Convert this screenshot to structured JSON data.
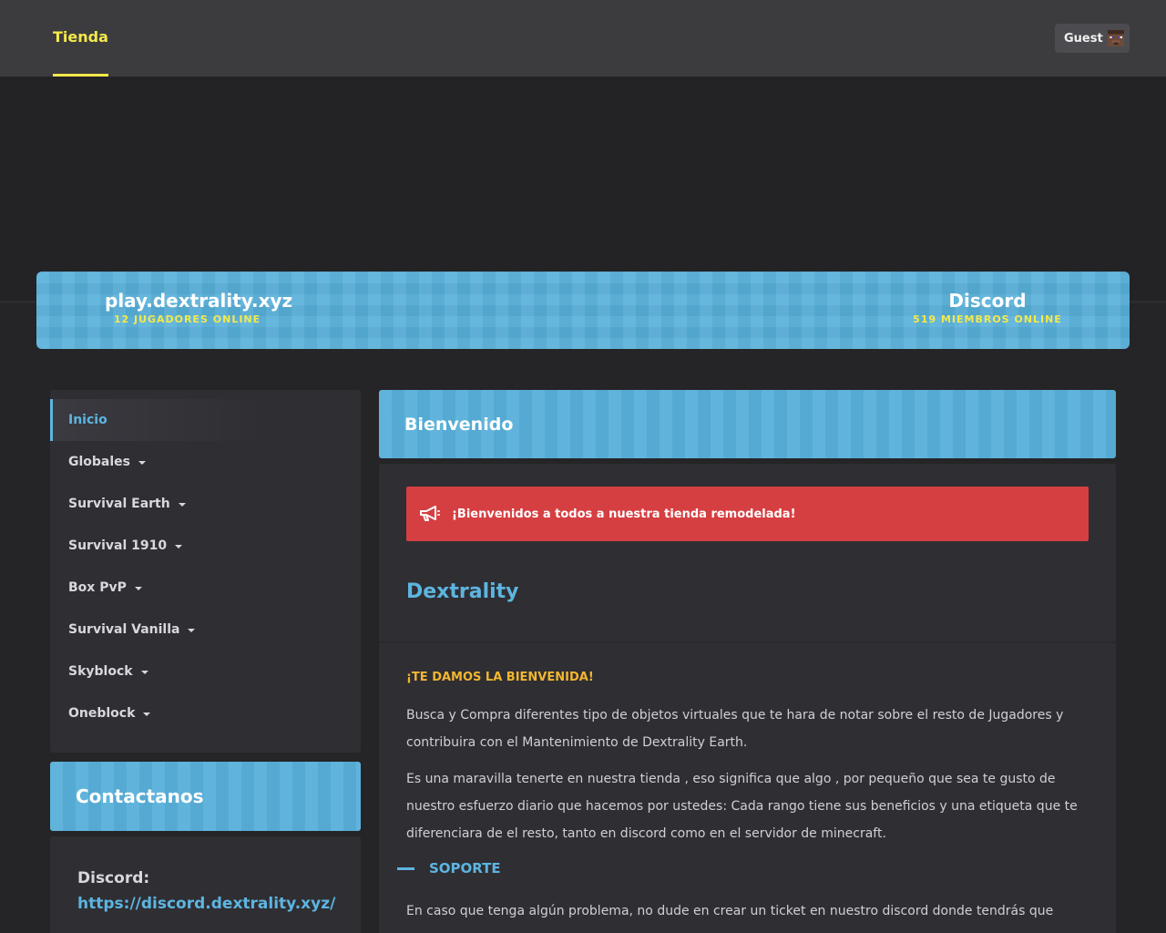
{
  "topbar": {
    "brand": "Tienda",
    "user_label": "Guest"
  },
  "server": {
    "address": "play.dextrality.xyz",
    "players": "12 JUGADORES ONLINE",
    "discord_title": "Discord",
    "discord_members": "519 MIEMBROS ONLINE"
  },
  "sidebar": {
    "items": [
      {
        "label": "Inicio",
        "active": true
      },
      {
        "label": "Globales",
        "dropdown": true
      },
      {
        "label": "Survival Earth",
        "dropdown": true
      },
      {
        "label": "Survival 1910",
        "dropdown": true
      },
      {
        "label": "Box PvP",
        "dropdown": true
      },
      {
        "label": "Survival Vanilla",
        "dropdown": true
      },
      {
        "label": "Skyblock",
        "dropdown": true
      },
      {
        "label": "Oneblock",
        "dropdown": true
      }
    ]
  },
  "contact": {
    "title": "Contactanos",
    "discord_label": "Discord:",
    "discord_link": "https://discord.dextrality.xyz/"
  },
  "main": {
    "title": "Bienvenido",
    "alert": "¡Bienvenidos a todos a nuestra tienda remodelada!",
    "brand_title": "Dextrality",
    "welcome": "¡TE DAMOS LA BIENVENIDA!",
    "para1": "Busca y Compra diferentes tipo de objetos virtuales que te hara de notar sobre el resto de Jugadores y contribuira con el Mantenimiento de Dextrality Earth.",
    "para2": "Es una maravilla tenerte en nuestra tienda , eso significa que algo , por pequeño que sea te gusto de nuestro esfuerzo diario que hacemos por ustedes: Cada rango tiene sus beneficios y una etiqueta que te diferenciara de el resto, tanto en discord como en el servidor de minecraft.",
    "support": "SOPORTE",
    "para3": "En caso que tenga algún problema, no dude en crear un ticket en nuestro discord donde tendrás que"
  },
  "colors": {
    "accent_blue": "#58b0da",
    "accent_yellow": "#f4e94a",
    "alert_red": "#d63f42",
    "heading_orange": "#f2b630"
  }
}
